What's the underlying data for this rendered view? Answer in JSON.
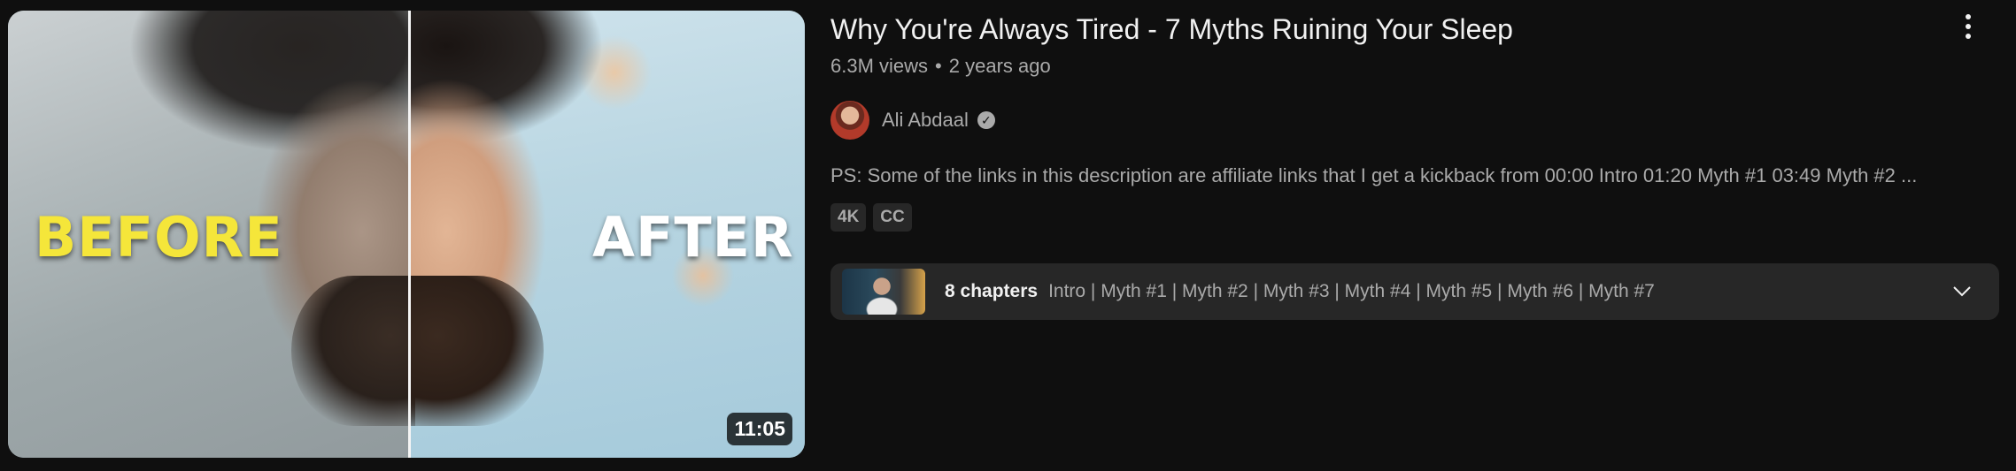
{
  "video": {
    "title": "Why You're Always Tired - 7 Myths Ruining Your Sleep",
    "views": "6.3M views",
    "separator": "•",
    "published": "2 years ago",
    "duration": "11:05",
    "thumbnail": {
      "before_text": "BEFORE",
      "after_text": "AFTER"
    }
  },
  "channel": {
    "name": "Ali Abdaal",
    "verified": true
  },
  "description": "PS: Some of the links in this description are affiliate links that I get a kickback from 00:00 Intro 01:20 Myth #1 03:49 Myth #2 ...",
  "badges": [
    "4K",
    "CC"
  ],
  "chapters": {
    "count_label": "8 chapters",
    "list": "Intro | Myth #1 | Myth #2 | Myth #3 | Myth #4 | Myth #5 | Myth #6 | Myth #7"
  },
  "icons": {
    "more": "more-vert-icon",
    "verified": "verified-check-icon",
    "expand": "chevron-down-icon"
  },
  "colors": {
    "background": "#0f0f0f",
    "text_primary": "#f1f1f1",
    "text_secondary": "#aaaaaa",
    "chip_bg": "#272727",
    "before_text": "#f5e63a"
  }
}
